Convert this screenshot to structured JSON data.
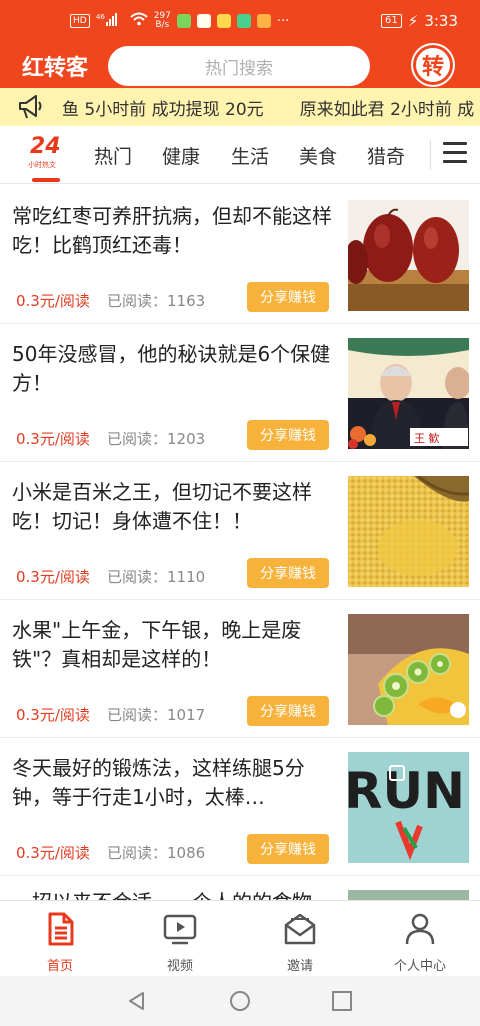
{
  "status_bar": {
    "badges": [
      "HD",
      "⁴⁶"
    ],
    "net_speed": "297\nB/s",
    "battery": "61",
    "time": "3:33",
    "more": "···"
  },
  "header": {
    "app_title": "红转客",
    "search_placeholder": "热门搜索",
    "logo_char": "转"
  },
  "ticker": {
    "items": [
      "鱼 5小时前 成功提现 20元",
      "原来如此君 2小时前 成"
    ]
  },
  "tabs": {
    "brand_num": "24",
    "brand_sub": "小时热文",
    "items": [
      "热门",
      "健康",
      "生活",
      "美食",
      "猎奇"
    ]
  },
  "articles": [
    {
      "title": "常吃红枣可养肝抗病，但却不能这样吃！比鹤顶红还毒！",
      "price": "0.3元/阅读",
      "reads": "已阅读：1163",
      "share": "分享赚钱"
    },
    {
      "title": "50年没感冒，他的秘诀就是6个保健方！",
      "price": "0.3元/阅读",
      "reads": "已阅读：1203",
      "share": "分享赚钱",
      "caption": "王 歓"
    },
    {
      "title": "小米是百米之王，但切记不要这样吃！切记！身体遭不住！！",
      "price": "0.3元/阅读",
      "reads": "已阅读：1110",
      "share": "分享赚钱"
    },
    {
      "title": "水果\"上午金，下午银，晚上是废铁\"？真相却是这样的！",
      "price": "0.3元/阅读",
      "reads": "已阅读：1017",
      "share": "分享赚钱"
    },
    {
      "title": "冬天最好的锻炼法，这样练腿5分钟，等于行走1小时，太棒…",
      "price": "0.3元/阅读",
      "reads": "已阅读：1086",
      "share": "分享赚钱",
      "caption": "RUN"
    }
  ],
  "peek_title": "一招以来不合适，一个人的的食物…",
  "bottom_nav": [
    {
      "label": "首页",
      "active": true
    },
    {
      "label": "视频",
      "active": false
    },
    {
      "label": "邀请",
      "active": false
    },
    {
      "label": "个人中心",
      "active": false
    }
  ],
  "colors": {
    "brand": "#f0461e",
    "ticker_bg": "#fff3b0",
    "share_btn": "#f7b23b",
    "price": "#e23c20"
  },
  "icons": {
    "ticker": "megaphone-icon",
    "menu": "menu-icon",
    "nav": [
      "home-doc-icon",
      "video-icon",
      "invite-mail-icon",
      "person-icon"
    ],
    "system": [
      "back-icon",
      "home-icon",
      "recents-icon"
    ]
  }
}
